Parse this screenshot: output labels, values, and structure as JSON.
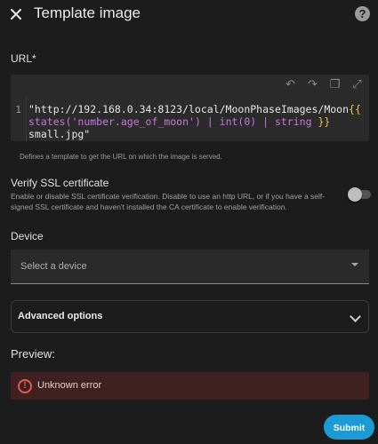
{
  "header": {
    "title": "Template image",
    "close_icon": "close-icon",
    "help_icon": "help-icon",
    "help_glyph": "?"
  },
  "url": {
    "label": "URL*",
    "line_number": "1",
    "code_parts": {
      "p1": "\"http://192.168.0.34:8123/local/MoonPhaseImages/Moon",
      "p2": "{{",
      "p3": "states(",
      "p4": "'number.age_of_moon'",
      "p5": ") | int(0) | string ",
      "p6": "}}",
      "p7": "small.jpg\""
    },
    "hint": "Defines a template to get the URL on which the image is served."
  },
  "ssl": {
    "title": "Verify SSL certificate",
    "description": "Enable or disable SSL certificate verification. Disable to use an http URL, or if you have a self-signed SSL certificate and haven't installed the CA certificate to enable verification.",
    "enabled": false
  },
  "device": {
    "label": "Device",
    "placeholder": "Select a device"
  },
  "advanced": {
    "label": "Advanced options"
  },
  "preview": {
    "label": "Preview:",
    "error_text": "Unknown error",
    "error_glyph": "!"
  },
  "actions": {
    "submit_label": "Submit"
  },
  "colors": {
    "accent": "#1a9bd6",
    "error": "#e45a50",
    "background": "#1c1c1c"
  }
}
